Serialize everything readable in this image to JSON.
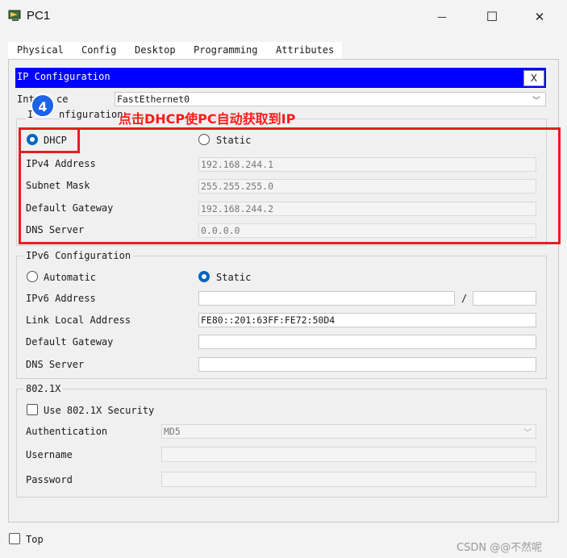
{
  "window": {
    "title": "PC1",
    "minimize": "—",
    "maximize": "☐",
    "close": "✕"
  },
  "tabs": [
    {
      "label": "Physical"
    },
    {
      "label": "Config"
    },
    {
      "label": "Desktop"
    },
    {
      "label": "Programming"
    },
    {
      "label": "Attributes"
    }
  ],
  "active_tab": "Desktop",
  "ip_config": {
    "title": "IP Configuration",
    "close_label": "X",
    "interface_label": "Interface",
    "interface_label_visible": "Int",
    "interface_label_tail": "ce",
    "interface_value": "FastEthernet0",
    "ipv4_section_label_tail": "nfiguration",
    "ipv4_section_label_head": "I",
    "dhcp_label": "DHCP",
    "static_label": "Static",
    "ipv4_address_label": "IPv4 Address",
    "ipv4_address": "192.168.244.1",
    "subnet_mask_label": "Subnet Mask",
    "subnet_mask": "255.255.255.0",
    "gateway_label": "Default Gateway",
    "gateway": "192.168.244.2",
    "dns_label": "DNS Server",
    "dns": "0.0.0.0"
  },
  "ipv6": {
    "section_label": "IPv6 Configuration",
    "automatic_label": "Automatic",
    "static_label": "Static",
    "address_label": "IPv6 Address",
    "address": "",
    "slash": "/",
    "prefix": "",
    "link_local_label": "Link Local Address",
    "link_local": "FE80::201:63FF:FE72:50D4",
    "gateway_label": "Default Gateway",
    "gateway": "",
    "dns_label": "DNS Server",
    "dns": ""
  },
  "dot1x": {
    "section_label": "802.1X",
    "use_label": "Use 802.1X Security",
    "auth_label": "Authentication",
    "auth_value": "MD5",
    "username_label": "Username",
    "password_label": "Password"
  },
  "footer": {
    "top_label": "Top"
  },
  "annotation": {
    "step": "4",
    "text": "点击DHCP使PC自动获取到IP",
    "color": "#e61e1e"
  },
  "watermark": "CSDN @@不然呢",
  "colors": {
    "title_bar_blue": "#0000ff",
    "radio_selected": "#0067c0",
    "badge": "#1c64e6"
  }
}
